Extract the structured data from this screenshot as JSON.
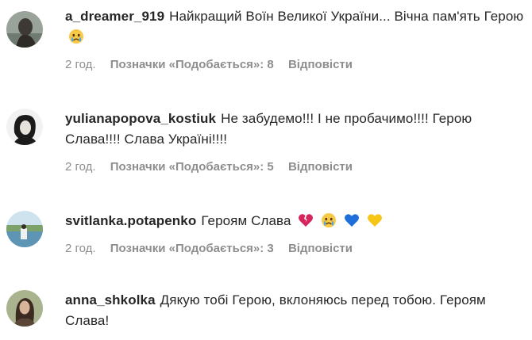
{
  "comments": [
    {
      "username": "a_dreamer_919",
      "text": "Найкращий Воїн Великої України... Вічна пам'ять Герою",
      "time": "2 год.",
      "likes": "Позначки «Подобається»: 8",
      "reply": "Відповісти"
    },
    {
      "username": "yulianapopova_kostiuk",
      "text": "Не забудемо!!! І не пробачимо!!!! Герою Слава!!!! Слава Україні!!!!",
      "time": "2 год.",
      "likes": "Позначки «Подобається»: 5",
      "reply": "Відповісти"
    },
    {
      "username": "svitlanka.potapenko",
      "text": "Героям Слава",
      "time": "2 год.",
      "likes": "Позначки «Подобається»: 3",
      "reply": "Відповісти"
    },
    {
      "username": "anna_shkolka",
      "text": "Дякую тобі Герою, вклоняюсь перед тобою. Героям Слава!",
      "time": "",
      "likes": "",
      "reply": ""
    }
  ],
  "icons": [
    "crying-face-emoji",
    "broken-heart-emoji",
    "blue-heart-emoji",
    "yellow-heart-emoji"
  ]
}
